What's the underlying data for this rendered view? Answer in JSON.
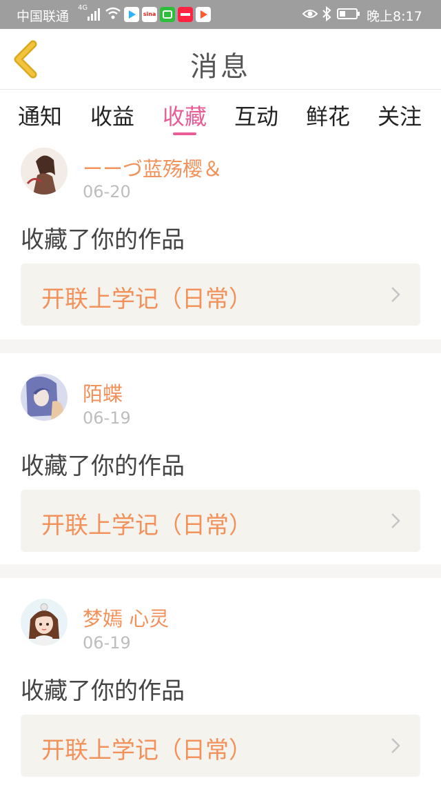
{
  "status_bar": {
    "carrier": "中国联通",
    "network": "4G",
    "time": "晚上8:17",
    "app_icons": [
      "video-app-icon",
      "sina-icon",
      "iqiyi-icon",
      "xiaohongshu-icon",
      "player-icon"
    ],
    "app_icon_texts": [
      "",
      "sina",
      "",
      "",
      ""
    ]
  },
  "header": {
    "title": "消息",
    "back_icon": "chevron-left-icon"
  },
  "tabs": [
    {
      "label": "通知"
    },
    {
      "label": "收益"
    },
    {
      "label": "收藏",
      "active": true
    },
    {
      "label": "互动"
    },
    {
      "label": "鲜花"
    },
    {
      "label": "关注"
    }
  ],
  "items": [
    {
      "username": "ーーづ蓝殇樱＆",
      "date": "06-20",
      "action": "收藏了你的作品",
      "work_title": "开联上学记（日常）"
    },
    {
      "username": "陌蝶",
      "date": "06-19",
      "action": "收藏了你的作品",
      "work_title": "开联上学记（日常）"
    },
    {
      "username": "梦嫣 心灵",
      "date": "06-19",
      "action": "收藏了你的作品",
      "work_title": "开联上学记（日常）"
    }
  ],
  "colors": {
    "accent": "#e85d96",
    "username": "#f2915a",
    "back_arrow": "#f3c33c",
    "work_bg": "#f4f3ee"
  }
}
